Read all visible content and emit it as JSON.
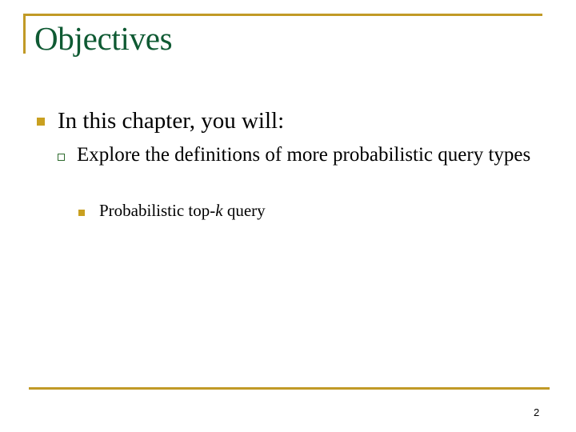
{
  "slide": {
    "title": "Objectives",
    "bullets": [
      {
        "text": "In this chapter, you will:",
        "sub": [
          {
            "text": "Explore the definitions of more probabilistic query types",
            "sub": [
              {
                "text_before": "Probabilistic top-",
                "text_italic": "k",
                "text_after": " query"
              }
            ]
          }
        ]
      }
    ],
    "page_number": "2"
  },
  "colors": {
    "accent_gold": "#c19a26",
    "title_green": "#0f5a33",
    "bullet_gold": "#c9a020",
    "sub_bullet_border": "#2e6b2e"
  }
}
